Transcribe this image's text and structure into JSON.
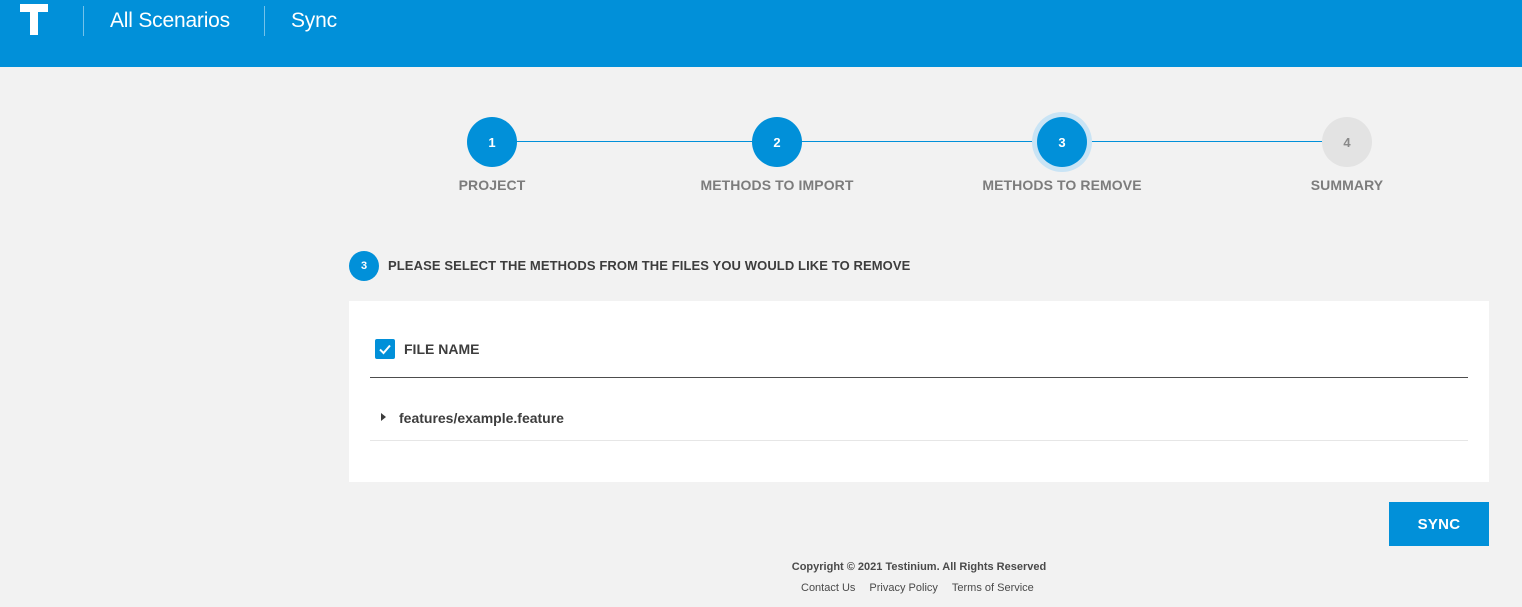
{
  "header": {
    "logo_icon": "testinium-t-logo",
    "nav": [
      "All Scenarios",
      "Sync"
    ]
  },
  "stepper": {
    "current_step": 3,
    "steps": [
      {
        "number": "1",
        "label": "PROJECT",
        "state": "done"
      },
      {
        "number": "2",
        "label": "METHODS TO IMPORT",
        "state": "done"
      },
      {
        "number": "3",
        "label": "METHODS TO REMOVE",
        "state": "active"
      },
      {
        "number": "4",
        "label": "SUMMARY",
        "state": "todo"
      }
    ]
  },
  "section": {
    "badge": "3",
    "title": "PLEASE SELECT THE METHODS FROM THE FILES YOU WOULD LIKE TO REMOVE"
  },
  "table": {
    "select_all_checked": true,
    "column_header": "FILE NAME",
    "rows": [
      {
        "label": "features/example.feature",
        "expanded": false
      }
    ]
  },
  "actions": {
    "sync_label": "SYNC"
  },
  "footer": {
    "copyright": "Copyright © 2021 Testinium. All Rights Reserved",
    "links": [
      "Contact Us",
      "Privacy Policy",
      "Terms of Service"
    ]
  },
  "colors": {
    "primary": "#0190d9",
    "background": "#f2f2f2",
    "pending_step": "#e3e3e3"
  }
}
